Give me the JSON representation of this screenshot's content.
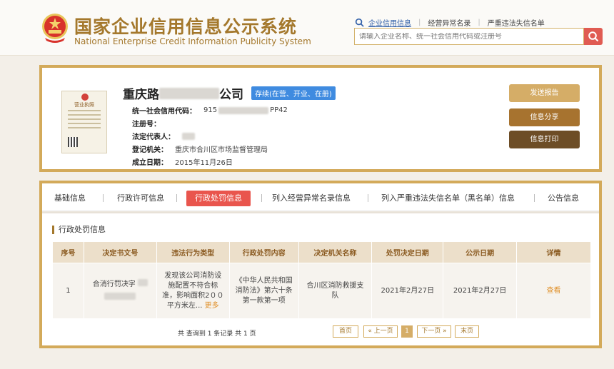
{
  "brand": {
    "title_cn": "国家企业信用信息公示系统",
    "title_en": "National Enterprise Credit Information Publicity System"
  },
  "top_nav": {
    "links": [
      "企业信用信息",
      "经营异常名录",
      "严重违法失信名单"
    ]
  },
  "search": {
    "placeholder": "请输入企业名称、统一社会信用代码或注册号"
  },
  "company": {
    "name_prefix": "重庆路",
    "name_suffix": "公司",
    "status": "存续(在营、开业、在册)",
    "license_label": "营业执照",
    "fields": [
      {
        "label": "统一社会信用代码：",
        "value_prefix": "915",
        "value_suffix": "PP42"
      },
      {
        "label": "注册号：",
        "value_prefix": "",
        "value_suffix": ""
      },
      {
        "label": "法定代表人：",
        "value_prefix": "",
        "value_suffix": ""
      },
      {
        "label": "登记机关：",
        "value_prefix": "重庆市合川区市场监督管理局",
        "value_suffix": ""
      },
      {
        "label": "成立日期：",
        "value_prefix": "2015年11月26日",
        "value_suffix": ""
      }
    ],
    "actions": [
      "发送报告",
      "信息分享",
      "信息打印"
    ]
  },
  "tabs": {
    "items": [
      "基础信息",
      "行政许可信息",
      "行政处罚信息",
      "列入经营异常名录信息",
      "列入严重违法失信名单（黑名单）信息",
      "公告信息"
    ],
    "active": "行政处罚信息"
  },
  "penalty": {
    "section_title": "行政处罚信息",
    "columns": [
      "序号",
      "决定书文号",
      "违法行为类型",
      "行政处罚内容",
      "决定机关名称",
      "处罚决定日期",
      "公示日期",
      "详情"
    ],
    "rows": [
      {
        "index": "1",
        "doc_no": "合消行罚决字",
        "violation": "发现该公司消防设施配置不符合标准，影响面积2００平方米左...",
        "violation_more": "更多",
        "content": "《中华人民共和国消防法》第六十条第一款第一项",
        "authority": "合川区消防救援支队",
        "decision_date": "2021年2月27日",
        "publish_date": "2021年2月27日",
        "detail": "查看"
      }
    ]
  },
  "pagination": {
    "summary": "共 查询到 1 条记录 共 1 页",
    "first": "首页",
    "prev": "« 上一页",
    "current": "1",
    "next": "下一页 »",
    "last": "末页"
  },
  "colors": {
    "accent_gold": "#d3aa5a",
    "brand_brown": "#a4782c",
    "active_tab_red": "#e9554d",
    "status_blue": "#3f8be0"
  }
}
